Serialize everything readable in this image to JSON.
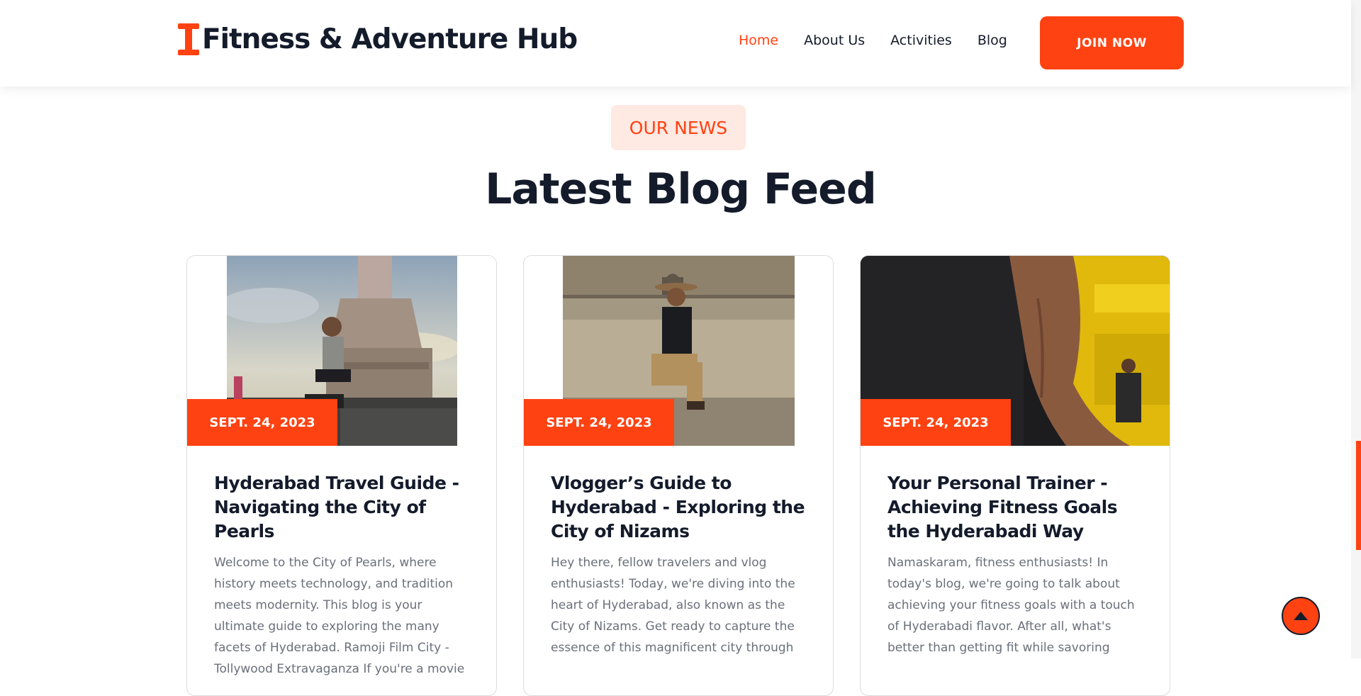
{
  "header": {
    "brand_name": "Fitness & Adventure Hub",
    "nav": [
      "Home",
      "About Us",
      "Activities",
      "Blog"
    ],
    "active_nav": "Home",
    "join_label": "JOIN NOW"
  },
  "section": {
    "tag": "OUR NEWS",
    "title": "Latest Blog Feed"
  },
  "posts": [
    {
      "date": "SEPT. 24, 2023",
      "title": "Hyderabad Travel Guide - Navigating the City of Pearls",
      "excerpt": "Welcome to the City of Pearls, where history meets technology, and tradition meets modernity. This blog is your ultimate guide to exploring the many facets of Hyderabad. Ramoji Film City - Tollywood Extravaganza If you're a movie"
    },
    {
      "date": "SEPT. 24, 2023",
      "title": "Vlogger’s Guide to Hyderabad - Exploring the City of Nizams",
      "excerpt": "Hey there, fellow travelers and vlog enthusiasts! Today, we're diving into the heart of Hyderabad, also known as the City of Nizams. Get ready to capture the essence of this magnificent city through"
    },
    {
      "date": "SEPT. 24, 2023",
      "title": "Your Personal Trainer - Achieving Fitness Goals the Hyderabadi Way",
      "excerpt": "Namaskaram, fitness enthusiasts! In today's blog, we're going to talk about achieving your fitness goals with a touch of Hyderabadi flavor. After all, what's better than getting fit while savoring"
    }
  ],
  "colors": {
    "accent": "#ff4212",
    "dark": "#141b2b",
    "tag_bg": "#ffe9e3",
    "body_text": "#6a6f7a"
  },
  "icons": {
    "brand": "dumbbell-icon",
    "scroll_top": "arrow-up-icon"
  }
}
